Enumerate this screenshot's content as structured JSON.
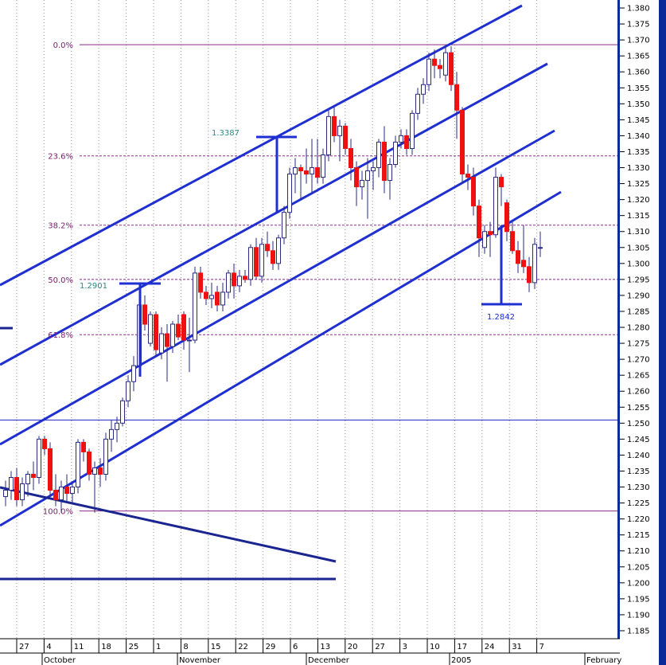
{
  "chart_data": {
    "type": "candlestick",
    "colors": {
      "up_body": "#ffffff",
      "down_body": "#ee1111",
      "wick": "#2a2a80",
      "channel": "#1f2fd0",
      "fib_level": "#8a2a8a",
      "axis_panel": "#0a2a9a",
      "level_line": "#2020c0",
      "annotation_teal": "#2a8a80"
    },
    "y_axis": {
      "range": [
        1.1825,
        1.3825
      ],
      "ticks": [
        "1.185",
        "1.190",
        "1.195",
        "1.200",
        "1.205",
        "1.210",
        "1.215",
        "1.220",
        "1.225",
        "1.230",
        "1.235",
        "1.240",
        "1.245",
        "1.250",
        "1.255",
        "1.260",
        "1.265",
        "1.270",
        "1.275",
        "1.280",
        "1.285",
        "1.290",
        "1.295",
        "1.300",
        "1.305",
        "1.310",
        "1.315",
        "1.320",
        "1.325",
        "1.330",
        "1.335",
        "1.340",
        "1.345",
        "1.350",
        "1.355",
        "1.360",
        "1.365",
        "1.370",
        "1.375",
        "1.380"
      ]
    },
    "x_axis": {
      "day_ticks": [
        "27",
        "4",
        "11",
        "18",
        "25",
        "1",
        "8",
        "15",
        "22",
        "29",
        "6",
        "13",
        "20",
        "27",
        "3",
        "10",
        "17",
        "24",
        "31",
        "7"
      ],
      "month_labels": [
        "October",
        "November",
        "December",
        "2005",
        "February"
      ]
    },
    "fib_levels": [
      {
        "label": "0.0%",
        "value": 1.3685
      },
      {
        "label": "23.6%",
        "value": 1.3337
      },
      {
        "label": "38.2%",
        "value": 1.312
      },
      {
        "label": "50.0%",
        "value": 1.295
      },
      {
        "label": "61.8%",
        "value": 1.2777
      },
      {
        "label": "100.0%",
        "value": 1.2225
      }
    ],
    "horizontal_levels": [
      1.251,
      1.199
    ],
    "annotations": [
      {
        "label": "1.3387",
        "value": 1.3387
      },
      {
        "label": "1.2901",
        "value": 1.2901
      },
      {
        "label": "1.2842",
        "value": 1.2842
      }
    ],
    "candles": [
      {
        "o": 1.227,
        "h": 1.232,
        "l": 1.224,
        "c": 1.229
      },
      {
        "o": 1.229,
        "h": 1.235,
        "l": 1.226,
        "c": 1.233
      },
      {
        "o": 1.233,
        "h": 1.236,
        "l": 1.224,
        "c": 1.226
      },
      {
        "o": 1.226,
        "h": 1.233,
        "l": 1.224,
        "c": 1.231
      },
      {
        "o": 1.231,
        "h": 1.235,
        "l": 1.227,
        "c": 1.234
      },
      {
        "o": 1.234,
        "h": 1.238,
        "l": 1.229,
        "c": 1.233
      },
      {
        "o": 1.233,
        "h": 1.246,
        "l": 1.231,
        "c": 1.245
      },
      {
        "o": 1.245,
        "h": 1.246,
        "l": 1.24,
        "c": 1.242
      },
      {
        "o": 1.242,
        "h": 1.244,
        "l": 1.227,
        "c": 1.229
      },
      {
        "o": 1.229,
        "h": 1.234,
        "l": 1.224,
        "c": 1.226
      },
      {
        "o": 1.226,
        "h": 1.232,
        "l": 1.222,
        "c": 1.23
      },
      {
        "o": 1.23,
        "h": 1.234,
        "l": 1.225,
        "c": 1.228
      },
      {
        "o": 1.228,
        "h": 1.231,
        "l": 1.225,
        "c": 1.23
      },
      {
        "o": 1.23,
        "h": 1.245,
        "l": 1.228,
        "c": 1.244
      },
      {
        "o": 1.244,
        "h": 1.245,
        "l": 1.238,
        "c": 1.241
      },
      {
        "o": 1.241,
        "h": 1.242,
        "l": 1.232,
        "c": 1.234
      },
      {
        "o": 1.234,
        "h": 1.238,
        "l": 1.222,
        "c": 1.236
      },
      {
        "o": 1.236,
        "h": 1.239,
        "l": 1.23,
        "c": 1.234
      },
      {
        "o": 1.234,
        "h": 1.247,
        "l": 1.232,
        "c": 1.245
      },
      {
        "o": 1.245,
        "h": 1.251,
        "l": 1.241,
        "c": 1.248
      },
      {
        "o": 1.248,
        "h": 1.252,
        "l": 1.244,
        "c": 1.25
      },
      {
        "o": 1.25,
        "h": 1.258,
        "l": 1.249,
        "c": 1.257
      },
      {
        "o": 1.257,
        "h": 1.265,
        "l": 1.255,
        "c": 1.263
      },
      {
        "o": 1.263,
        "h": 1.271,
        "l": 1.26,
        "c": 1.268
      },
      {
        "o": 1.268,
        "h": 1.29,
        "l": 1.266,
        "c": 1.287
      },
      {
        "o": 1.287,
        "h": 1.29,
        "l": 1.279,
        "c": 1.281
      },
      {
        "o": 1.275,
        "h": 1.285,
        "l": 1.274,
        "c": 1.284
      },
      {
        "o": 1.284,
        "h": 1.285,
        "l": 1.271,
        "c": 1.273
      },
      {
        "o": 1.272,
        "h": 1.28,
        "l": 1.27,
        "c": 1.278
      },
      {
        "o": 1.278,
        "h": 1.281,
        "l": 1.263,
        "c": 1.274
      },
      {
        "o": 1.274,
        "h": 1.282,
        "l": 1.272,
        "c": 1.281
      },
      {
        "o": 1.281,
        "h": 1.284,
        "l": 1.276,
        "c": 1.277
      },
      {
        "o": 1.284,
        "h": 1.285,
        "l": 1.273,
        "c": 1.276
      },
      {
        "o": 1.276,
        "h": 1.283,
        "l": 1.266,
        "c": 1.276
      },
      {
        "o": 1.276,
        "h": 1.299,
        "l": 1.275,
        "c": 1.297
      },
      {
        "o": 1.297,
        "h": 1.299,
        "l": 1.289,
        "c": 1.291
      },
      {
        "o": 1.291,
        "h": 1.293,
        "l": 1.287,
        "c": 1.289
      },
      {
        "o": 1.289,
        "h": 1.294,
        "l": 1.286,
        "c": 1.29
      },
      {
        "o": 1.291,
        "h": 1.293,
        "l": 1.285,
        "c": 1.287
      },
      {
        "o": 1.287,
        "h": 1.294,
        "l": 1.285,
        "c": 1.291
      },
      {
        "o": 1.291,
        "h": 1.298,
        "l": 1.289,
        "c": 1.297
      },
      {
        "o": 1.297,
        "h": 1.3,
        "l": 1.289,
        "c": 1.293
      },
      {
        "o": 1.293,
        "h": 1.298,
        "l": 1.291,
        "c": 1.296
      },
      {
        "o": 1.296,
        "h": 1.298,
        "l": 1.294,
        "c": 1.295
      },
      {
        "o": 1.295,
        "h": 1.306,
        "l": 1.293,
        "c": 1.305
      },
      {
        "o": 1.305,
        "h": 1.308,
        "l": 1.295,
        "c": 1.296
      },
      {
        "o": 1.296,
        "h": 1.308,
        "l": 1.294,
        "c": 1.306
      },
      {
        "o": 1.306,
        "h": 1.31,
        "l": 1.302,
        "c": 1.304
      },
      {
        "o": 1.304,
        "h": 1.307,
        "l": 1.298,
        "c": 1.3
      },
      {
        "o": 1.3,
        "h": 1.309,
        "l": 1.298,
        "c": 1.308
      },
      {
        "o": 1.308,
        "h": 1.318,
        "l": 1.306,
        "c": 1.316
      },
      {
        "o": 1.316,
        "h": 1.33,
        "l": 1.314,
        "c": 1.328
      },
      {
        "o": 1.328,
        "h": 1.333,
        "l": 1.322,
        "c": 1.33
      },
      {
        "o": 1.33,
        "h": 1.331,
        "l": 1.32,
        "c": 1.329
      },
      {
        "o": 1.329,
        "h": 1.336,
        "l": 1.325,
        "c": 1.328
      },
      {
        "o": 1.328,
        "h": 1.339,
        "l": 1.322,
        "c": 1.33
      },
      {
        "o": 1.33,
        "h": 1.339,
        "l": 1.325,
        "c": 1.327
      },
      {
        "o": 1.327,
        "h": 1.336,
        "l": 1.325,
        "c": 1.334
      },
      {
        "o": 1.334,
        "h": 1.348,
        "l": 1.332,
        "c": 1.346
      },
      {
        "o": 1.346,
        "h": 1.349,
        "l": 1.338,
        "c": 1.34
      },
      {
        "o": 1.34,
        "h": 1.345,
        "l": 1.332,
        "c": 1.343
      },
      {
        "o": 1.343,
        "h": 1.344,
        "l": 1.334,
        "c": 1.336
      },
      {
        "o": 1.336,
        "h": 1.339,
        "l": 1.326,
        "c": 1.33
      },
      {
        "o": 1.33,
        "h": 1.332,
        "l": 1.318,
        "c": 1.324
      },
      {
        "o": 1.324,
        "h": 1.329,
        "l": 1.32,
        "c": 1.326
      },
      {
        "o": 1.326,
        "h": 1.333,
        "l": 1.314,
        "c": 1.329
      },
      {
        "o": 1.329,
        "h": 1.332,
        "l": 1.323,
        "c": 1.33
      },
      {
        "o": 1.33,
        "h": 1.339,
        "l": 1.327,
        "c": 1.338
      },
      {
        "o": 1.338,
        "h": 1.343,
        "l": 1.322,
        "c": 1.326
      },
      {
        "o": 1.326,
        "h": 1.333,
        "l": 1.32,
        "c": 1.331
      },
      {
        "o": 1.331,
        "h": 1.34,
        "l": 1.33,
        "c": 1.338
      },
      {
        "o": 1.338,
        "h": 1.342,
        "l": 1.336,
        "c": 1.34
      },
      {
        "o": 1.34,
        "h": 1.342,
        "l": 1.334,
        "c": 1.336
      },
      {
        "o": 1.336,
        "h": 1.348,
        "l": 1.334,
        "c": 1.347
      },
      {
        "o": 1.347,
        "h": 1.355,
        "l": 1.345,
        "c": 1.353
      },
      {
        "o": 1.353,
        "h": 1.358,
        "l": 1.35,
        "c": 1.356
      },
      {
        "o": 1.356,
        "h": 1.366,
        "l": 1.354,
        "c": 1.364
      },
      {
        "o": 1.364,
        "h": 1.367,
        "l": 1.358,
        "c": 1.362
      },
      {
        "o": 1.362,
        "h": 1.364,
        "l": 1.358,
        "c": 1.361
      },
      {
        "o": 1.359,
        "h": 1.368,
        "l": 1.357,
        "c": 1.366
      },
      {
        "o": 1.366,
        "h": 1.368,
        "l": 1.354,
        "c": 1.356
      },
      {
        "o": 1.356,
        "h": 1.36,
        "l": 1.339,
        "c": 1.348
      },
      {
        "o": 1.348,
        "h": 1.349,
        "l": 1.325,
        "c": 1.328
      },
      {
        "o": 1.328,
        "h": 1.331,
        "l": 1.323,
        "c": 1.327
      },
      {
        "o": 1.327,
        "h": 1.33,
        "l": 1.315,
        "c": 1.318
      },
      {
        "o": 1.318,
        "h": 1.32,
        "l": 1.302,
        "c": 1.308
      },
      {
        "o": 1.305,
        "h": 1.312,
        "l": 1.303,
        "c": 1.31
      },
      {
        "o": 1.31,
        "h": 1.313,
        "l": 1.302,
        "c": 1.309
      },
      {
        "o": 1.309,
        "h": 1.33,
        "l": 1.308,
        "c": 1.327
      },
      {
        "o": 1.327,
        "h": 1.328,
        "l": 1.318,
        "c": 1.324
      },
      {
        "o": 1.319,
        "h": 1.32,
        "l": 1.307,
        "c": 1.31
      },
      {
        "o": 1.31,
        "h": 1.313,
        "l": 1.303,
        "c": 1.304
      },
      {
        "o": 1.304,
        "h": 1.307,
        "l": 1.297,
        "c": 1.3
      },
      {
        "o": 1.301,
        "h": 1.312,
        "l": 1.297,
        "c": 1.299
      },
      {
        "o": 1.299,
        "h": 1.302,
        "l": 1.291,
        "c": 1.294
      },
      {
        "o": 1.294,
        "h": 1.308,
        "l": 1.292,
        "c": 1.306
      },
      {
        "o": 1.305,
        "h": 1.31,
        "l": 1.302,
        "c": 1.305
      }
    ]
  }
}
